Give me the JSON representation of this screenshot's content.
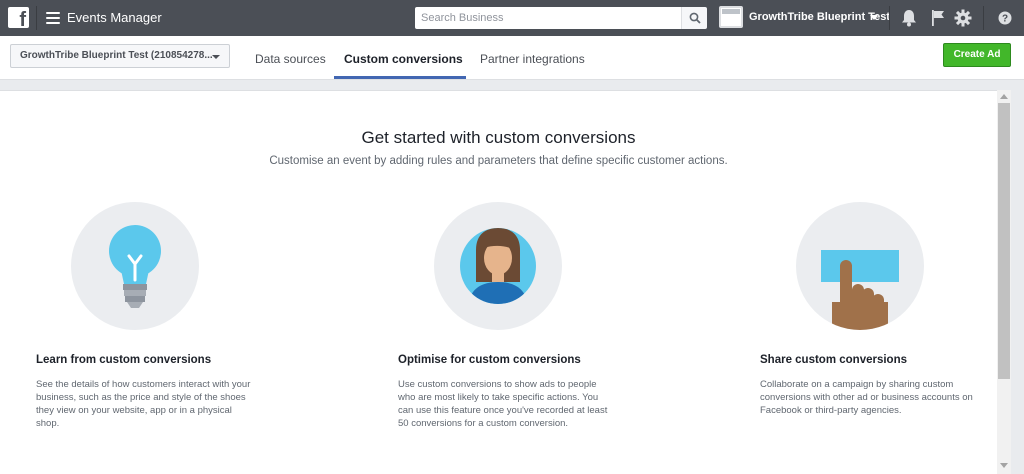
{
  "topbar": {
    "app_title": "Events Manager",
    "search_placeholder": "Search Business",
    "account_name": "GrowthTribe Blueprint Test"
  },
  "subnav": {
    "account_select": "GrowthTribe Blueprint Test (210854278...",
    "tabs": [
      {
        "label": "Data sources",
        "active": false
      },
      {
        "label": "Custom conversions",
        "active": true
      },
      {
        "label": "Partner integrations",
        "active": false
      }
    ],
    "create_ad_label": "Create Ad"
  },
  "main": {
    "title": "Get started with custom conversions",
    "subtitle": "Customise an event by adding rules and parameters that define specific customer actions.",
    "columns": [
      {
        "icon": "lightbulb-icon",
        "title": "Learn from custom conversions",
        "text": "See the details of how customers interact with your business, such as the price and style of the shoes they view on your website, app or in a physical shop."
      },
      {
        "icon": "person-icon",
        "title": "Optimise for custom conversions",
        "text": "Use custom conversions to show ads to people who are most likely to take specific actions. You can use this feature once you've recorded at least 50 conversions for a custom conversion."
      },
      {
        "icon": "share-hand-icon",
        "title": "Share custom conversions",
        "text": "Collaborate on a campaign by sharing custom conversions with other ad or business accounts on Facebook or third-party agencies."
      }
    ]
  },
  "colors": {
    "topbar": "#4b4f56",
    "accent": "#4267b2",
    "create_button": "#42b72a",
    "illustration_blue": "#5bc8ec",
    "illustration_bg": "#ebedf0"
  }
}
